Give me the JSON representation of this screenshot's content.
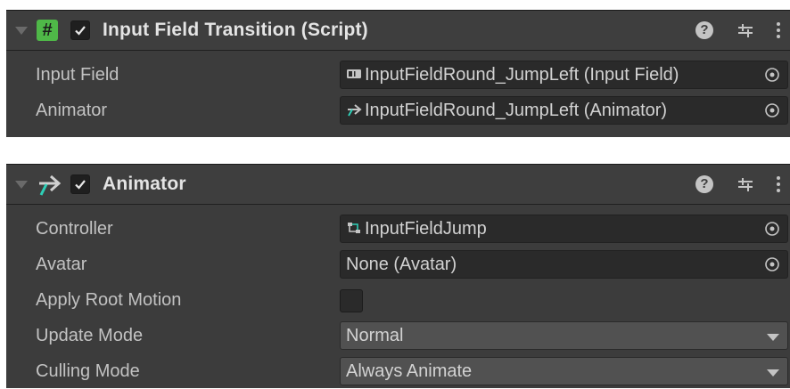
{
  "colors": {
    "panel_bg": "#3c3c3c",
    "field_bg": "#2a2a2a",
    "dropdown_bg": "#515151",
    "script_icon_green": "#4fb848",
    "animator_icon_teal": "#2ecfb7"
  },
  "script_component": {
    "icon": "script-hash-icon",
    "enabled": true,
    "title": "Input Field Transition (Script)",
    "fields": [
      {
        "label": "Input Field",
        "value": "InputFieldRound_JumpLeft (Input Field)",
        "icon": "input-field-icon"
      },
      {
        "label": "Animator",
        "value": "InputFieldRound_JumpLeft (Animator)",
        "icon": "animator-icon"
      }
    ]
  },
  "animator_component": {
    "icon": "animator-icon",
    "enabled": true,
    "title": "Animator",
    "fields": [
      {
        "label": "Controller",
        "value": "InputFieldJump",
        "icon": "animator-controller-icon"
      },
      {
        "label": "Avatar",
        "value": "None (Avatar)"
      },
      {
        "label": "Apply Root Motion",
        "checked": false
      },
      {
        "label": "Update Mode",
        "value": "Normal"
      },
      {
        "label": "Culling Mode",
        "value": "Always Animate"
      }
    ]
  }
}
